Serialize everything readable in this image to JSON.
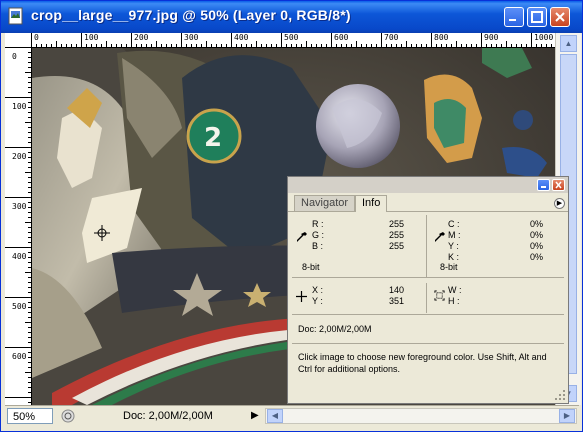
{
  "window": {
    "title": "crop__large__977.jpg @ 50% (Layer 0, RGB/8*)",
    "icon": "photoshop-document-icon"
  },
  "ruler": {
    "h_labels": [
      "0",
      "100",
      "200",
      "300",
      "400",
      "500",
      "600",
      "700",
      "800",
      "900",
      "1000"
    ],
    "v_labels": [
      "0",
      "100",
      "200",
      "300",
      "400",
      "500",
      "600"
    ]
  },
  "statusbar": {
    "zoom": "50%",
    "doc": "Doc: 2,00M/2,00M"
  },
  "palette": {
    "tabs": [
      "Navigator",
      "Info"
    ],
    "active_tab": "Info",
    "rgb": {
      "labels": [
        "R :",
        "G :",
        "B :"
      ],
      "values": [
        "255",
        "255",
        "255"
      ],
      "bitdepth": "8-bit"
    },
    "cmyk": {
      "labels": [
        "C :",
        "M :",
        "Y :",
        "K :"
      ],
      "values": [
        "0%",
        "0%",
        "0%",
        "0%"
      ],
      "bitdepth": "8-bit"
    },
    "xy": {
      "labels": [
        "X :",
        "Y :"
      ],
      "values": [
        "140",
        "351"
      ]
    },
    "wh": {
      "labels": [
        "W :",
        "H :"
      ]
    },
    "doc": "Doc: 2,00M/2,00M",
    "help": "Click image to choose new foreground color.  Use Shift, Alt and Ctrl for additional options."
  },
  "colors": {
    "titlebar": "#0a5ee8",
    "chrome": "#ece9d8"
  }
}
